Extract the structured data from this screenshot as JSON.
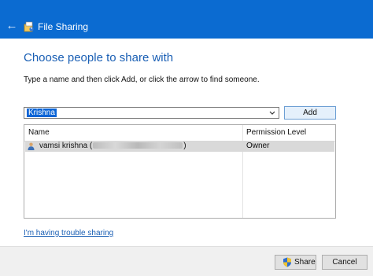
{
  "window": {
    "title": "File Sharing"
  },
  "dialog": {
    "heading": "Choose people to share with",
    "instructions": "Type a name and then click Add, or click the arrow to find someone."
  },
  "name_input": {
    "value": "Krishna"
  },
  "add_button": {
    "label": "Add"
  },
  "table": {
    "headers": {
      "name": "Name",
      "permission": "Permission Level"
    },
    "rows": [
      {
        "name": "vamsi krishna",
        "permission": "Owner"
      }
    ]
  },
  "help_link": "I'm having trouble sharing",
  "footer": {
    "share_label": "Share",
    "cancel_label": "Cancel"
  },
  "colors": {
    "titlebar": "#0b6bd1",
    "heading": "#1a5fb4",
    "selection": "#0a64d6",
    "row_highlight": "#d9d9d9"
  },
  "icons": [
    "back-arrow-icon",
    "file-sharing-icon",
    "dropdown-arrow-icon",
    "person-icon",
    "uac-shield-icon"
  ]
}
